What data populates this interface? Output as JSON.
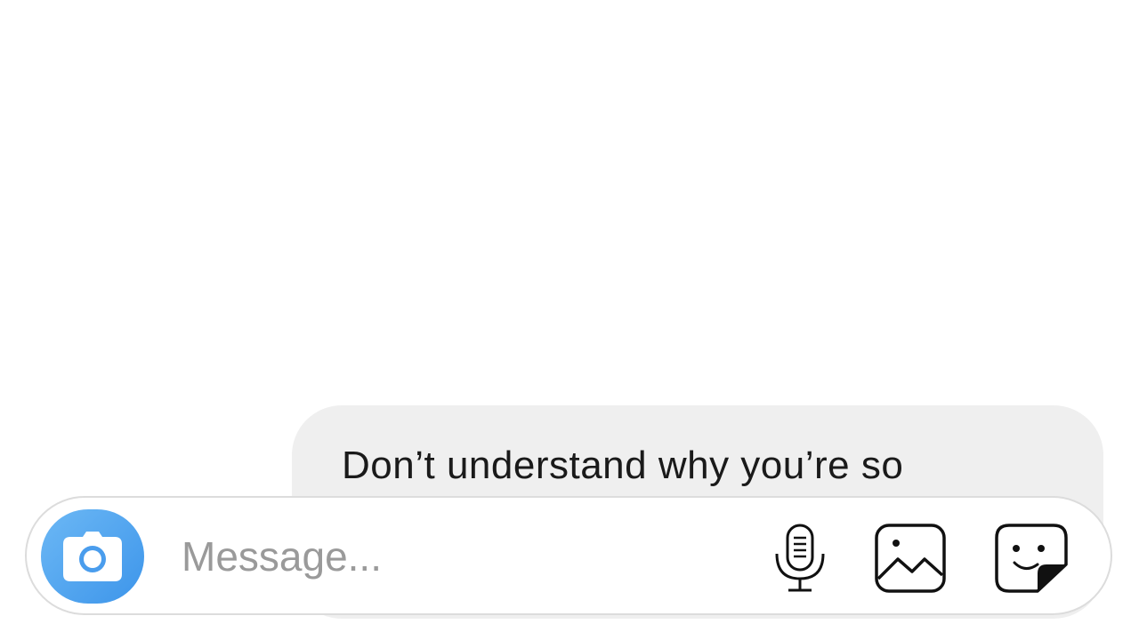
{
  "conversation": {
    "messages": [
      {
        "text": "Don’t understand why you’re so"
      }
    ]
  },
  "composer": {
    "placeholder": "Message...",
    "value": "",
    "camera_icon": "camera-icon",
    "mic_icon": "microphone-icon",
    "gallery_icon": "image-icon",
    "sticker_icon": "sticker-icon"
  },
  "colors": {
    "accent": "#3d95ea",
    "bubble": "#efefef",
    "placeholder": "#9a9a9a"
  }
}
